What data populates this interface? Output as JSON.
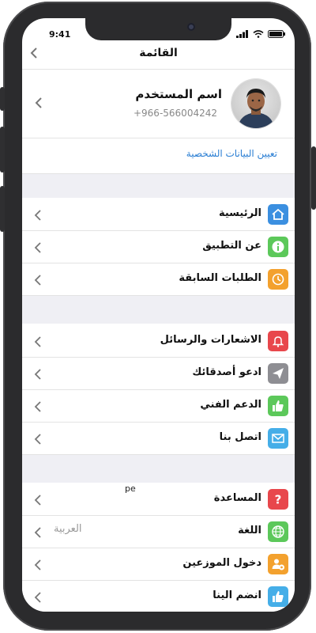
{
  "status": {
    "time": "9:41"
  },
  "header": {
    "title": "القائمة"
  },
  "profile": {
    "name": "اسم المستخدم",
    "phone": "+966-566004242",
    "edit_link": "تعيين البيانات الشخصية"
  },
  "menu": {
    "group1": [
      {
        "label": "الرئيسية",
        "icon": "home-icon",
        "color": "#3b8fe0"
      },
      {
        "label": "عن التطبيق",
        "icon": "info-icon",
        "color": "#5cc85a"
      },
      {
        "label": "الطلبات السابقة",
        "icon": "history-icon",
        "color": "#f3a12e"
      }
    ],
    "group2": [
      {
        "label": "الاشعارات والرسائل",
        "icon": "bell-icon",
        "color": "#e8474c"
      },
      {
        "label": "ادعو أصدقائك",
        "icon": "send-icon",
        "color": "#8e8e93"
      },
      {
        "label": "الدعم الفني",
        "icon": "thumbs-up-icon",
        "color": "#5cc85a"
      },
      {
        "label": "اتصل بنا",
        "icon": "mail-icon",
        "color": "#45aee8"
      }
    ],
    "group3": [
      {
        "label": "المساعدة",
        "icon": "question-icon",
        "color": "#e8474c"
      },
      {
        "label": "اللغة",
        "icon": "globe-icon",
        "color": "#5cc85a",
        "value": "العربية"
      },
      {
        "label": "دخول الموزعين",
        "icon": "distributor-icon",
        "color": "#f3a12e"
      },
      {
        "label": "انضم الينا",
        "icon": "join-icon",
        "color": "#45aee8"
      }
    ]
  },
  "stray_text": "pe"
}
